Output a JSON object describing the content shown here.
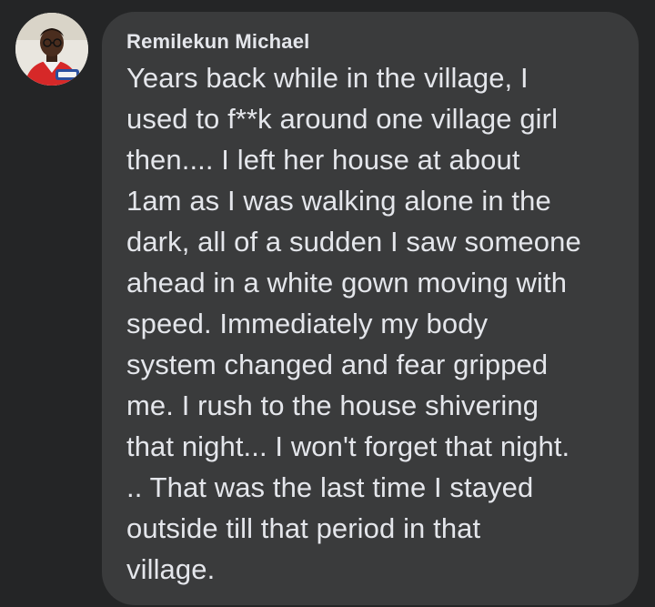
{
  "comment": {
    "author": "Remilekun Michael",
    "avatar_icon": "profile-photo-icon",
    "lines": [
      "Years back while in the village, I",
      "used to f**k around one village girl",
      "then.... I left her house at about",
      "1am as I was walking alone in the",
      "dark, all of a sudden I saw someone",
      "ahead in a white gown moving with",
      "speed. Immediately my body",
      "system changed and fear gripped",
      "me. I rush to the house shivering",
      "that night... I won't forget that night.",
      ".. That was the last time I stayed",
      "outside till that period in that",
      "village."
    ]
  },
  "colors": {
    "page_background": "#242526",
    "bubble_background": "#3a3b3c",
    "text": "#e4e6eb"
  }
}
